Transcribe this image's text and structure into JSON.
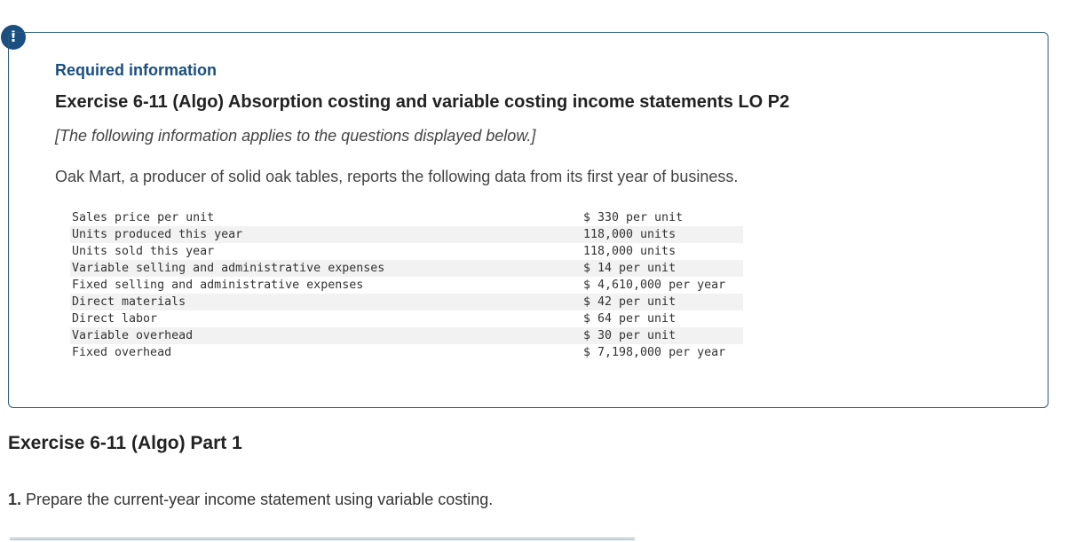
{
  "alert": {
    "symbol": "!"
  },
  "info": {
    "required_title": "Required information",
    "exercise_title": "Exercise 6-11 (Algo) Absorption costing and variable costing income statements LO P2",
    "note": "[The following information applies to the questions displayed below.]",
    "intro": "Oak Mart, a producer of solid oak tables, reports the following data from its first year of business.",
    "rows": [
      {
        "label": "Sales price per unit",
        "value": "$ 330 per unit"
      },
      {
        "label": "Units produced this year",
        "value": "118,000 units"
      },
      {
        "label": "Units sold this year",
        "value": "118,000 units"
      },
      {
        "label": "Variable selling and administrative expenses",
        "value": "$ 14 per unit"
      },
      {
        "label": "Fixed selling and administrative expenses",
        "value": "$ 4,610,000 per year"
      },
      {
        "label": "Direct materials",
        "value": "$ 42 per unit"
      },
      {
        "label": "Direct labor",
        "value": "$ 64 per unit"
      },
      {
        "label": "Variable overhead",
        "value": "$ 30 per unit"
      },
      {
        "label": "Fixed overhead",
        "value": "$ 7,198,000 per year"
      }
    ]
  },
  "part": {
    "title": "Exercise 6-11 (Algo) Part 1",
    "question_number": "1.",
    "question_text": "Prepare the current-year income statement using variable costing."
  },
  "colors": {
    "accent": "#1a4f7f",
    "border": "#2a5a7e",
    "row_stripe": "#f2f2f2"
  }
}
